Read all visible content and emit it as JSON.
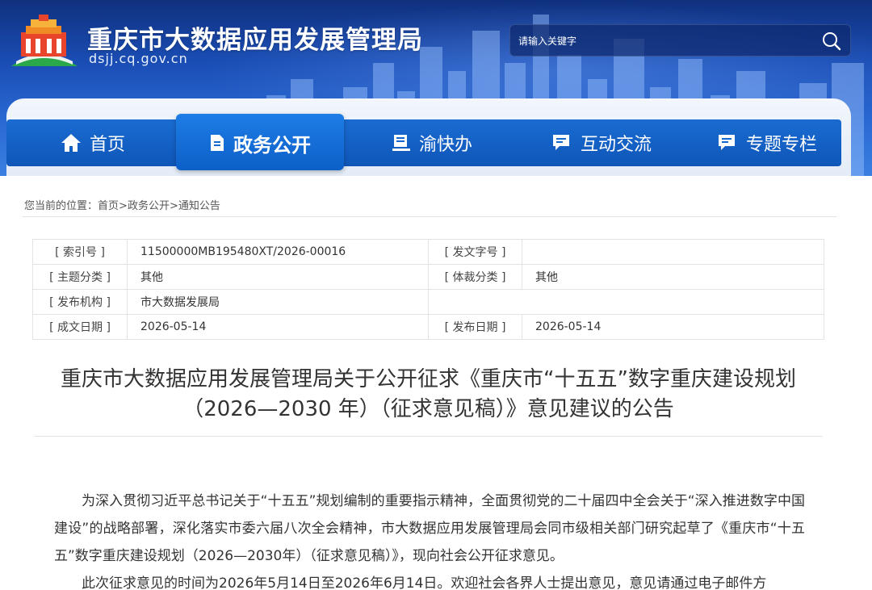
{
  "header": {
    "site_title": "重庆市大数据应用发展管理局",
    "site_domain": "dsjj.cq.gov.cn",
    "search_placeholder": "请输入关键字"
  },
  "nav": {
    "items": [
      {
        "label": "首页",
        "icon": "home-icon"
      },
      {
        "label": "政务公开",
        "icon": "document-icon",
        "active": true
      },
      {
        "label": "渝快办",
        "icon": "service-icon"
      },
      {
        "label": "互动交流",
        "icon": "chat-icon"
      },
      {
        "label": "专题专栏",
        "icon": "topic-icon"
      }
    ]
  },
  "breadcrumb": {
    "prefix": "您当前的位置：",
    "items": [
      "首页",
      "政务公开",
      "通知公告"
    ],
    "separator": ">"
  },
  "meta": {
    "rows": [
      {
        "k1": "[ 索引号 ]",
        "v1": "11500000MB195480XT/2026-00016",
        "k2": "[ 发文字号 ]",
        "v2": ""
      },
      {
        "k1": "[ 主题分类 ]",
        "v1": "其他",
        "k2": "[ 体裁分类 ]",
        "v2": "其他"
      },
      {
        "k1": "[ 发布机构 ]",
        "v1": "市大数据发展局",
        "k2": "",
        "v2": ""
      },
      {
        "k1": "[ 成文日期 ]",
        "v1": "2026-05-14",
        "k2": "[ 发布日期 ]",
        "v2": "2026-05-14"
      }
    ]
  },
  "article": {
    "title_line1": "重庆市大数据应用发展管理局关于公开征求《重庆市“十五五”数字重庆建设规划",
    "title_line2": "（2026—2030 年）（征求意见稿）》意见建议的公告",
    "paragraph1": "为深入贯彻习近平总书记关于“十五五”规划编制的重要指示精神，全面贯彻党的二十届四中全会关于“深入推进数字中国建设”的战略部署，深化落实市委六届八次全会精神，市大数据应用发展管理局会同市级相关部门研究起草了《重庆市“十五五”数字重庆建设规划（2026—2030年）（征求意见稿）》，现向社会公开征求意见。",
    "paragraph2": "此次征求意见的时间为2026年5月14日至2026年6月14日。欢迎社会各界人士提出意见，意见请通过电子邮件方"
  },
  "colors": {
    "banner_dark": "#10307e",
    "nav_blue": "#0f56b8",
    "nav_active": "#1e7de6"
  }
}
